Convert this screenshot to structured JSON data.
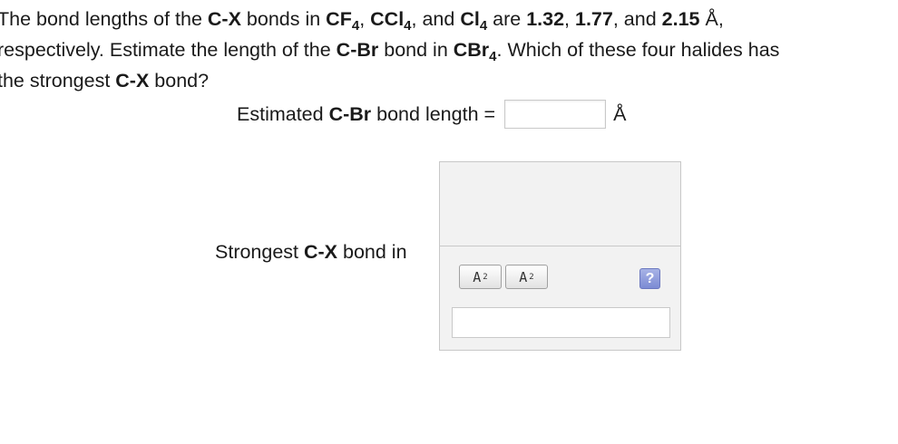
{
  "question": {
    "line1": {
      "t1": "The bond lengths of the ",
      "b1": "C-X",
      "t2": " bonds in ",
      "b2": "CF",
      "s2": "4",
      "t3": ", ",
      "b3": "CCl",
      "s3": "4",
      "t4": ", and ",
      "b4": "Cl",
      "s4": "4",
      "t5": " are ",
      "b5": "1.32",
      "t6": ", ",
      "b6": "1.77",
      "t7": ", and ",
      "b7": "2.15",
      "t8": " Å,"
    },
    "line2": {
      "t1": "respectively. Estimate the length of the ",
      "b1": "C-Br",
      "t2": " bond in ",
      "b2": "CBr",
      "s2": "4",
      "t3": ". Which of these four halides has"
    },
    "line3": {
      "t1": "the strongest ",
      "b1": "C-X",
      "t2": " bond?"
    }
  },
  "estimate": {
    "label_pre": "Estimated ",
    "label_bold": "C-Br",
    "label_post": " bond length =",
    "value": "",
    "unit": "Å"
  },
  "strongest": {
    "label_pre": "Strongest ",
    "label_bold": "C-X",
    "label_post": " bond in",
    "value": ""
  },
  "toolbar": {
    "subscript_label": "A",
    "subscript_mark": "2",
    "superscript_label": "A",
    "superscript_mark": "2",
    "help_label": "?"
  }
}
